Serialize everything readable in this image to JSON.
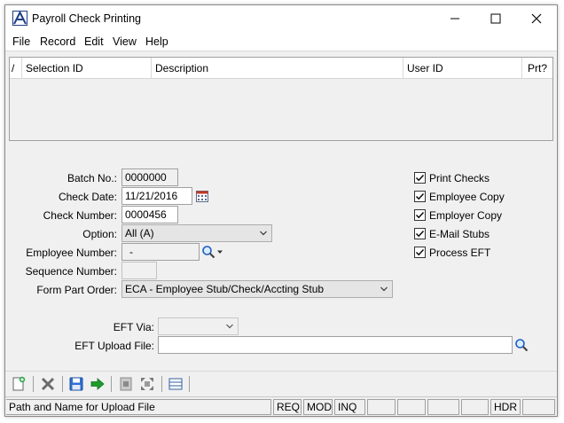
{
  "window": {
    "title": "Payroll Check Printing"
  },
  "menu": [
    "File",
    "Record",
    "Edit",
    "View",
    "Help"
  ],
  "grid": {
    "columns": [
      "/",
      "Selection ID",
      "Description",
      "User ID",
      "Prt?"
    ]
  },
  "form": {
    "batch_no": {
      "label": "Batch No.:",
      "value": "0000000"
    },
    "check_date": {
      "label": "Check Date:",
      "value": "11/21/2016"
    },
    "check_number": {
      "label": "Check Number:",
      "value": "0000456"
    },
    "option": {
      "label": "Option:",
      "value": "All (A)"
    },
    "employee_number": {
      "label": "Employee Number:",
      "value": "-"
    },
    "sequence_number": {
      "label": "Sequence Number:",
      "value": ""
    },
    "form_part_order": {
      "label": "Form Part Order:",
      "value": "ECA - Employee Stub/Check/Accting Stub"
    },
    "eft_via": {
      "label": "EFT Via:",
      "value": ""
    },
    "eft_upload_file": {
      "label": "EFT Upload File:",
      "value": ""
    }
  },
  "checkboxes": [
    {
      "label": "Print Checks",
      "checked": true
    },
    {
      "label": "Employee Copy",
      "checked": true
    },
    {
      "label": "Employer Copy",
      "checked": true
    },
    {
      "label": "E-Mail Stubs",
      "checked": true
    },
    {
      "label": "Process EFT",
      "checked": true
    }
  ],
  "status": {
    "message": "Path and Name for Upload File",
    "req": "REQ",
    "mod": "MOD",
    "inq": "INQ",
    "hdr": "HDR"
  },
  "colors": {
    "titlebar": "#ffffff",
    "window": "#f0f0f0",
    "accent_blue": "#1f5fbf",
    "green_arrow": "#1c9c2c"
  }
}
